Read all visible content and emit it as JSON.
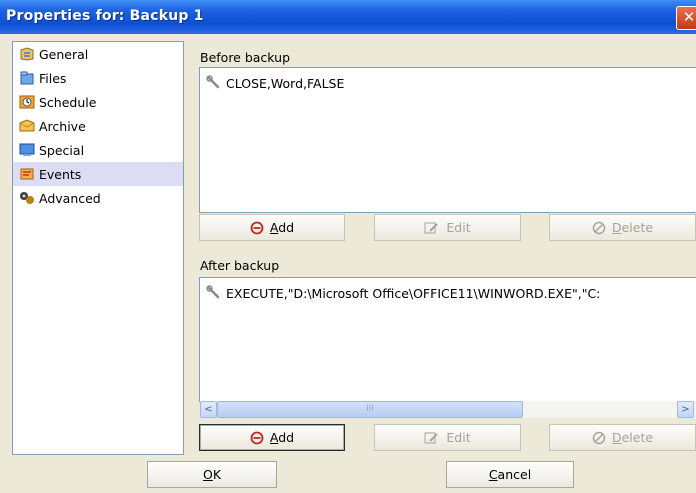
{
  "window": {
    "title": "Properties for: Backup 1",
    "close_label": "✕"
  },
  "nav": {
    "items": [
      {
        "label": "General",
        "icon": "general-icon"
      },
      {
        "label": "Files",
        "icon": "files-icon"
      },
      {
        "label": "Schedule",
        "icon": "schedule-icon"
      },
      {
        "label": "Archive",
        "icon": "archive-icon"
      },
      {
        "label": "Special",
        "icon": "special-icon"
      },
      {
        "label": "Events",
        "icon": "events-icon",
        "selected": true
      },
      {
        "label": "Advanced",
        "icon": "advanced-icon"
      }
    ]
  },
  "before": {
    "label": "Before backup",
    "items": [
      "CLOSE,Word,FALSE"
    ],
    "buttons": {
      "add_pre": "",
      "add_u": "A",
      "add_post": "dd",
      "edit": "Edit",
      "delete_u": "D",
      "delete_post": "elete"
    }
  },
  "after": {
    "label": "After backup",
    "items": [
      "EXECUTE,\"D:\\Microsoft Office\\OFFICE11\\WINWORD.EXE\",\"C:"
    ],
    "scroll_left": "<",
    "scroll_right": ">",
    "scroll_grip": "III",
    "buttons": {
      "add_u": "A",
      "add_post": "dd",
      "edit": "Edit",
      "delete_u": "D",
      "delete_post": "elete"
    }
  },
  "footer": {
    "ok_u": "O",
    "ok_post": "K",
    "cancel_u": "C",
    "cancel_post": "ancel"
  }
}
